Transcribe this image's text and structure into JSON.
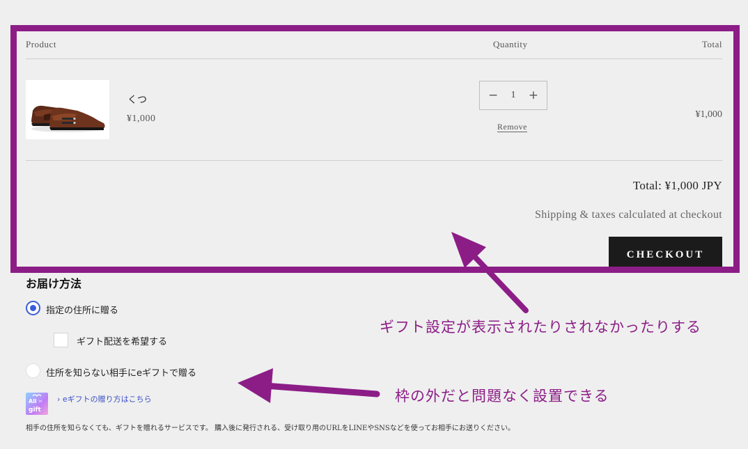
{
  "cart": {
    "headers": {
      "product": "Product",
      "quantity": "Quantity",
      "total": "Total"
    },
    "item": {
      "name": "くつ",
      "price": "¥1,000",
      "quantity": "1",
      "decrement_icon": "minus-icon",
      "increment_icon": "plus-icon",
      "remove_label": "Remove",
      "line_total": "¥1,000"
    },
    "total": "Total: ¥1,000 JPY",
    "shipping_note": "Shipping & taxes calculated at checkout",
    "checkout_label": "CHECKOUT"
  },
  "delivery": {
    "title": "お届け方法",
    "options": [
      {
        "label": "指定の住所に贈る",
        "selected": true
      },
      {
        "label": "住所を知らない相手にeギフトで贈る",
        "selected": false
      }
    ],
    "gift_checkbox_label": "ギフト配送を希望する",
    "gift_checkbox_checked": false,
    "gift_logo": "All in gift",
    "gift_link": "eギフトの贈り方はこちら",
    "gift_description": "相手の住所を知らなくても、ギフトを贈れるサービスです。 購入後に発行される、受け取り用のURLをLINEやSNSなどを使ってお相手にお送りください。"
  },
  "annotations": {
    "note_1": "ギフト設定が表示されたりされなかったりする",
    "note_2": "枠の外だと問題なく設置できる",
    "color": "#8c1d87"
  }
}
